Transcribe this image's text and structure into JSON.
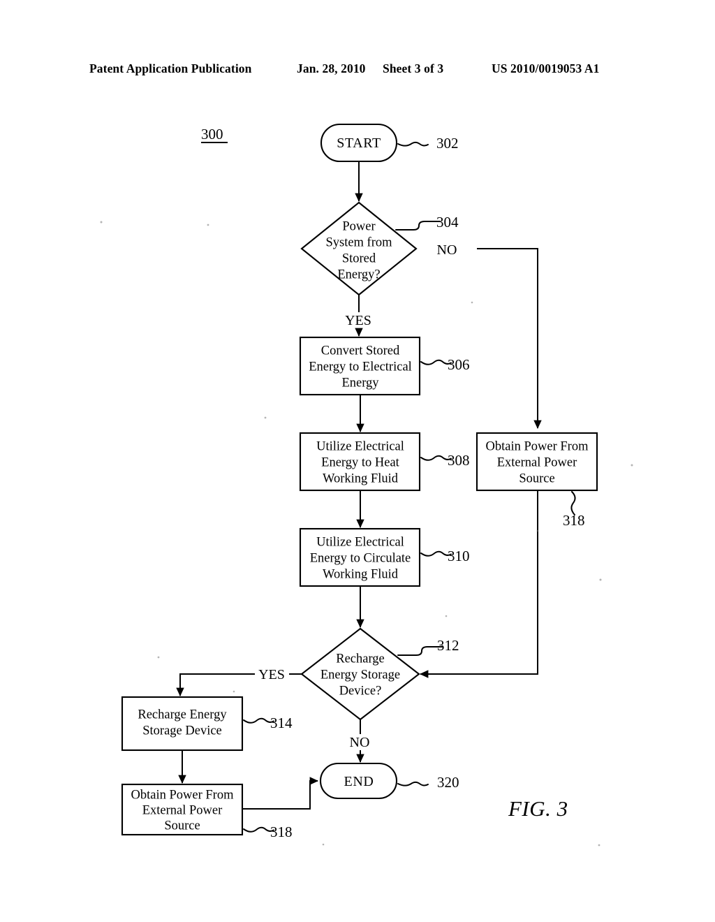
{
  "header": {
    "publication": "Patent Application Publication",
    "date": "Jan. 28, 2010",
    "sheet": "Sheet 3 of 3",
    "patent_number": "US 2010/0019053 A1"
  },
  "figure": {
    "caption": "FIG. 3",
    "diagram_ref": "300"
  },
  "flowchart": {
    "type": "flowchart",
    "nodes": [
      {
        "id": "302",
        "ref": "302",
        "shape": "terminator",
        "text": "START"
      },
      {
        "id": "304",
        "ref": "304",
        "shape": "decision",
        "text": "Power System from Stored Energy?",
        "lines": [
          "Power",
          "System from",
          "Stored",
          "Energy?"
        ]
      },
      {
        "id": "306",
        "ref": "306",
        "shape": "process",
        "text": "Convert Stored Energy to Electrical Energy",
        "lines": [
          "Convert Stored",
          "Energy to Electrical",
          "Energy"
        ]
      },
      {
        "id": "308",
        "ref": "308",
        "shape": "process",
        "text": "Utilize Electrical Energy to Heat Working Fluid",
        "lines": [
          "Utilize Electrical",
          "Energy to Heat",
          "Working Fluid"
        ]
      },
      {
        "id": "310",
        "ref": "310",
        "shape": "process",
        "text": "Utilize Electrical Energy to Circulate Working Fluid",
        "lines": [
          "Utilize Electrical",
          "Energy to Circulate",
          "Working Fluid"
        ]
      },
      {
        "id": "312",
        "ref": "312",
        "shape": "decision",
        "text": "Recharge Energy Storage Device?",
        "lines": [
          "Recharge",
          "Energy Storage",
          "Device?"
        ]
      },
      {
        "id": "314",
        "ref": "314",
        "shape": "process",
        "text": "Recharge Energy Storage Device",
        "lines": [
          "Recharge Energy",
          "Storage Device"
        ]
      },
      {
        "id": "318r",
        "ref": "318",
        "shape": "process",
        "text": "Obtain Power From External Power Source",
        "lines": [
          "Obtain Power From",
          "External Power",
          "Source"
        ]
      },
      {
        "id": "318b",
        "ref": "318",
        "shape": "process",
        "text": "Obtain Power From External Power Source",
        "lines": [
          "Obtain Power From",
          "External Power",
          "Source"
        ]
      },
      {
        "id": "320",
        "ref": "320",
        "shape": "terminator",
        "text": "END"
      }
    ],
    "branch_labels": {
      "d304_yes": "YES",
      "d304_no": "NO",
      "d312_yes": "YES",
      "d312_no": "NO"
    },
    "edges": [
      {
        "from": "302",
        "to": "304",
        "label": ""
      },
      {
        "from": "304",
        "to": "306",
        "label": "YES"
      },
      {
        "from": "304",
        "to": "318r",
        "label": "NO"
      },
      {
        "from": "306",
        "to": "308",
        "label": ""
      },
      {
        "from": "308",
        "to": "310",
        "label": ""
      },
      {
        "from": "310",
        "to": "312",
        "label": ""
      },
      {
        "from": "318r",
        "to": "312",
        "label": ""
      },
      {
        "from": "312",
        "to": "314",
        "label": "YES"
      },
      {
        "from": "312",
        "to": "320",
        "label": "NO"
      },
      {
        "from": "314",
        "to": "318b",
        "label": ""
      },
      {
        "from": "318b",
        "to": "320",
        "label": ""
      }
    ]
  }
}
